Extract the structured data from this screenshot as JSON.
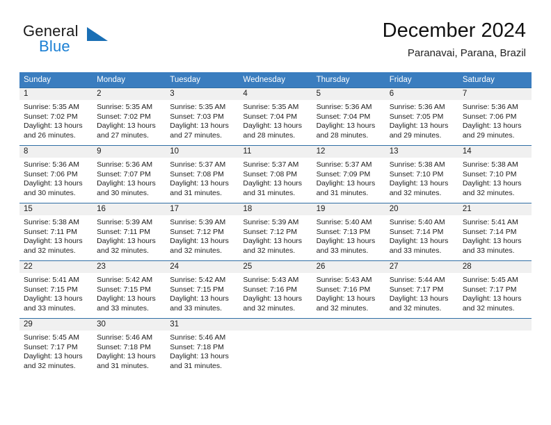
{
  "brand": {
    "name_part1": "General",
    "name_part2": "Blue",
    "logo_icon": "triangle-flag-icon",
    "colors": {
      "text": "#1a1a1a",
      "accent": "#1a7fd4"
    }
  },
  "header": {
    "title": "December 2024",
    "subtitle": "Paranavai, Parana, Brazil"
  },
  "theme": {
    "header_bg": "#3a7dbf",
    "row_divider": "#2e6da4",
    "daynum_bg": "#f0f0f0"
  },
  "columns": [
    {
      "label": "Sunday"
    },
    {
      "label": "Monday"
    },
    {
      "label": "Tuesday"
    },
    {
      "label": "Wednesday"
    },
    {
      "label": "Thursday"
    },
    {
      "label": "Friday"
    },
    {
      "label": "Saturday"
    }
  ],
  "weeks": [
    {
      "days": [
        {
          "day": "1",
          "sunrise": "Sunrise: 5:35 AM",
          "sunset": "Sunset: 7:02 PM",
          "daylight_line1": "Daylight: 13 hours",
          "daylight_line2": "and 26 minutes."
        },
        {
          "day": "2",
          "sunrise": "Sunrise: 5:35 AM",
          "sunset": "Sunset: 7:02 PM",
          "daylight_line1": "Daylight: 13 hours",
          "daylight_line2": "and 27 minutes."
        },
        {
          "day": "3",
          "sunrise": "Sunrise: 5:35 AM",
          "sunset": "Sunset: 7:03 PM",
          "daylight_line1": "Daylight: 13 hours",
          "daylight_line2": "and 27 minutes."
        },
        {
          "day": "4",
          "sunrise": "Sunrise: 5:35 AM",
          "sunset": "Sunset: 7:04 PM",
          "daylight_line1": "Daylight: 13 hours",
          "daylight_line2": "and 28 minutes."
        },
        {
          "day": "5",
          "sunrise": "Sunrise: 5:36 AM",
          "sunset": "Sunset: 7:04 PM",
          "daylight_line1": "Daylight: 13 hours",
          "daylight_line2": "and 28 minutes."
        },
        {
          "day": "6",
          "sunrise": "Sunrise: 5:36 AM",
          "sunset": "Sunset: 7:05 PM",
          "daylight_line1": "Daylight: 13 hours",
          "daylight_line2": "and 29 minutes."
        },
        {
          "day": "7",
          "sunrise": "Sunrise: 5:36 AM",
          "sunset": "Sunset: 7:06 PM",
          "daylight_line1": "Daylight: 13 hours",
          "daylight_line2": "and 29 minutes."
        }
      ]
    },
    {
      "days": [
        {
          "day": "8",
          "sunrise": "Sunrise: 5:36 AM",
          "sunset": "Sunset: 7:06 PM",
          "daylight_line1": "Daylight: 13 hours",
          "daylight_line2": "and 30 minutes."
        },
        {
          "day": "9",
          "sunrise": "Sunrise: 5:36 AM",
          "sunset": "Sunset: 7:07 PM",
          "daylight_line1": "Daylight: 13 hours",
          "daylight_line2": "and 30 minutes."
        },
        {
          "day": "10",
          "sunrise": "Sunrise: 5:37 AM",
          "sunset": "Sunset: 7:08 PM",
          "daylight_line1": "Daylight: 13 hours",
          "daylight_line2": "and 31 minutes."
        },
        {
          "day": "11",
          "sunrise": "Sunrise: 5:37 AM",
          "sunset": "Sunset: 7:08 PM",
          "daylight_line1": "Daylight: 13 hours",
          "daylight_line2": "and 31 minutes."
        },
        {
          "day": "12",
          "sunrise": "Sunrise: 5:37 AM",
          "sunset": "Sunset: 7:09 PM",
          "daylight_line1": "Daylight: 13 hours",
          "daylight_line2": "and 31 minutes."
        },
        {
          "day": "13",
          "sunrise": "Sunrise: 5:38 AM",
          "sunset": "Sunset: 7:10 PM",
          "daylight_line1": "Daylight: 13 hours",
          "daylight_line2": "and 32 minutes."
        },
        {
          "day": "14",
          "sunrise": "Sunrise: 5:38 AM",
          "sunset": "Sunset: 7:10 PM",
          "daylight_line1": "Daylight: 13 hours",
          "daylight_line2": "and 32 minutes."
        }
      ]
    },
    {
      "days": [
        {
          "day": "15",
          "sunrise": "Sunrise: 5:38 AM",
          "sunset": "Sunset: 7:11 PM",
          "daylight_line1": "Daylight: 13 hours",
          "daylight_line2": "and 32 minutes."
        },
        {
          "day": "16",
          "sunrise": "Sunrise: 5:39 AM",
          "sunset": "Sunset: 7:11 PM",
          "daylight_line1": "Daylight: 13 hours",
          "daylight_line2": "and 32 minutes."
        },
        {
          "day": "17",
          "sunrise": "Sunrise: 5:39 AM",
          "sunset": "Sunset: 7:12 PM",
          "daylight_line1": "Daylight: 13 hours",
          "daylight_line2": "and 32 minutes."
        },
        {
          "day": "18",
          "sunrise": "Sunrise: 5:39 AM",
          "sunset": "Sunset: 7:12 PM",
          "daylight_line1": "Daylight: 13 hours",
          "daylight_line2": "and 32 minutes."
        },
        {
          "day": "19",
          "sunrise": "Sunrise: 5:40 AM",
          "sunset": "Sunset: 7:13 PM",
          "daylight_line1": "Daylight: 13 hours",
          "daylight_line2": "and 33 minutes."
        },
        {
          "day": "20",
          "sunrise": "Sunrise: 5:40 AM",
          "sunset": "Sunset: 7:14 PM",
          "daylight_line1": "Daylight: 13 hours",
          "daylight_line2": "and 33 minutes."
        },
        {
          "day": "21",
          "sunrise": "Sunrise: 5:41 AM",
          "sunset": "Sunset: 7:14 PM",
          "daylight_line1": "Daylight: 13 hours",
          "daylight_line2": "and 33 minutes."
        }
      ]
    },
    {
      "days": [
        {
          "day": "22",
          "sunrise": "Sunrise: 5:41 AM",
          "sunset": "Sunset: 7:15 PM",
          "daylight_line1": "Daylight: 13 hours",
          "daylight_line2": "and 33 minutes."
        },
        {
          "day": "23",
          "sunrise": "Sunrise: 5:42 AM",
          "sunset": "Sunset: 7:15 PM",
          "daylight_line1": "Daylight: 13 hours",
          "daylight_line2": "and 33 minutes."
        },
        {
          "day": "24",
          "sunrise": "Sunrise: 5:42 AM",
          "sunset": "Sunset: 7:15 PM",
          "daylight_line1": "Daylight: 13 hours",
          "daylight_line2": "and 33 minutes."
        },
        {
          "day": "25",
          "sunrise": "Sunrise: 5:43 AM",
          "sunset": "Sunset: 7:16 PM",
          "daylight_line1": "Daylight: 13 hours",
          "daylight_line2": "and 32 minutes."
        },
        {
          "day": "26",
          "sunrise": "Sunrise: 5:43 AM",
          "sunset": "Sunset: 7:16 PM",
          "daylight_line1": "Daylight: 13 hours",
          "daylight_line2": "and 32 minutes."
        },
        {
          "day": "27",
          "sunrise": "Sunrise: 5:44 AM",
          "sunset": "Sunset: 7:17 PM",
          "daylight_line1": "Daylight: 13 hours",
          "daylight_line2": "and 32 minutes."
        },
        {
          "day": "28",
          "sunrise": "Sunrise: 5:45 AM",
          "sunset": "Sunset: 7:17 PM",
          "daylight_line1": "Daylight: 13 hours",
          "daylight_line2": "and 32 minutes."
        }
      ]
    },
    {
      "days": [
        {
          "day": "29",
          "sunrise": "Sunrise: 5:45 AM",
          "sunset": "Sunset: 7:17 PM",
          "daylight_line1": "Daylight: 13 hours",
          "daylight_line2": "and 32 minutes."
        },
        {
          "day": "30",
          "sunrise": "Sunrise: 5:46 AM",
          "sunset": "Sunset: 7:18 PM",
          "daylight_line1": "Daylight: 13 hours",
          "daylight_line2": "and 31 minutes."
        },
        {
          "day": "31",
          "sunrise": "Sunrise: 5:46 AM",
          "sunset": "Sunset: 7:18 PM",
          "daylight_line1": "Daylight: 13 hours",
          "daylight_line2": "and 31 minutes."
        },
        {
          "day": "",
          "sunrise": "",
          "sunset": "",
          "daylight_line1": "",
          "daylight_line2": ""
        },
        {
          "day": "",
          "sunrise": "",
          "sunset": "",
          "daylight_line1": "",
          "daylight_line2": ""
        },
        {
          "day": "",
          "sunrise": "",
          "sunset": "",
          "daylight_line1": "",
          "daylight_line2": ""
        },
        {
          "day": "",
          "sunrise": "",
          "sunset": "",
          "daylight_line1": "",
          "daylight_line2": ""
        }
      ]
    }
  ]
}
